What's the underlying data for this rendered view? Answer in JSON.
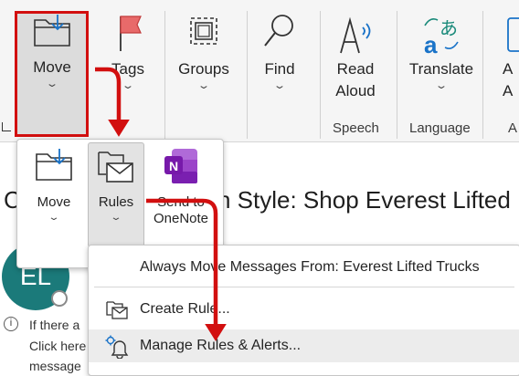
{
  "ribbon": {
    "move_label": "Move",
    "tags_label": "Tags",
    "groups_label": "Groups",
    "find_label": "Find",
    "read_aloud_label_1": "Read",
    "read_aloud_label_2": "Aloud",
    "translate_label": "Translate",
    "partial_label_1": "A",
    "partial_label_2": "A",
    "speech_group": "Speech",
    "language_group": "Language",
    "partial_group": "A"
  },
  "email": {
    "subject_left": "C",
    "subject_right": "n Style: Shop Everest Lifted",
    "avatar_initials": "EL",
    "info_line_1": "If there a",
    "info_line_2": "Click here",
    "info_line_3": "message"
  },
  "move_dropdown": {
    "move_label": "Move",
    "rules_label": "Rules",
    "send_to_line_1": "Send to",
    "send_to_line_2": "OneNote"
  },
  "rules_menu": {
    "items": [
      {
        "label": "Always Move Messages From: Everest Lifted Trucks"
      },
      {
        "label": "Create Rule..."
      },
      {
        "label": "Manage Rules & Alerts..."
      }
    ]
  },
  "colors": {
    "highlight_border": "#d20f0f",
    "annotation_arrow": "#d20f0f",
    "avatar_bg": "#1b7a7a",
    "onenote": "#7719aa"
  }
}
